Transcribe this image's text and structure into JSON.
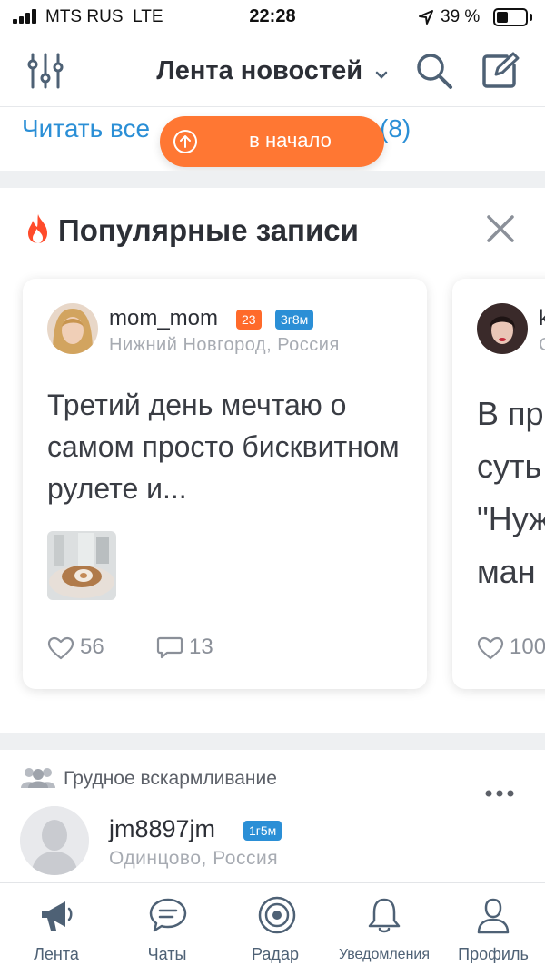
{
  "status_bar": {
    "carrier": "MTS RUS",
    "network": "LTE",
    "time": "22:28",
    "battery_percent": "39 %",
    "battery_level": 0.39
  },
  "header": {
    "title": "Лента новостей",
    "icons": [
      "filters-icon",
      "chevron-down-icon",
      "search-icon",
      "compose-icon"
    ]
  },
  "read_all": {
    "label": "Читать все",
    "count": "(8)"
  },
  "scroll_top": {
    "label": "в начало"
  },
  "popular": {
    "title": "Популярные записи",
    "cards": [
      {
        "username": "mom_mom",
        "badge_age": "23",
        "badge_kid": "3г8м",
        "location": "Нижний Новгород, Россия",
        "text": "Третий день мечтаю о самом просто бисквитном рулете и...",
        "likes": "56",
        "comments": "13"
      },
      {
        "username": "k",
        "location": "С",
        "text": "В пр\nсуть\n\"Нуж\nман",
        "likes": "100"
      }
    ]
  },
  "post": {
    "group": "Грудное вскармливание",
    "username": "jm8897jm",
    "badge_kid": "1г5м",
    "location": "Одинцово, Россия"
  },
  "tabbar": {
    "tabs": [
      {
        "label": "Лента",
        "icon": "megaphone-icon",
        "active": true
      },
      {
        "label": "Чаты",
        "icon": "chat-bubble-icon"
      },
      {
        "label": "Радар",
        "icon": "radar-icon"
      },
      {
        "label": "Уведомления",
        "icon": "bell-icon"
      },
      {
        "label": "Профиль",
        "icon": "person-icon"
      }
    ]
  },
  "colors": {
    "accent_orange": "#ff7733",
    "link_blue": "#2b8fd6",
    "tab_icon": "#4e6175"
  }
}
